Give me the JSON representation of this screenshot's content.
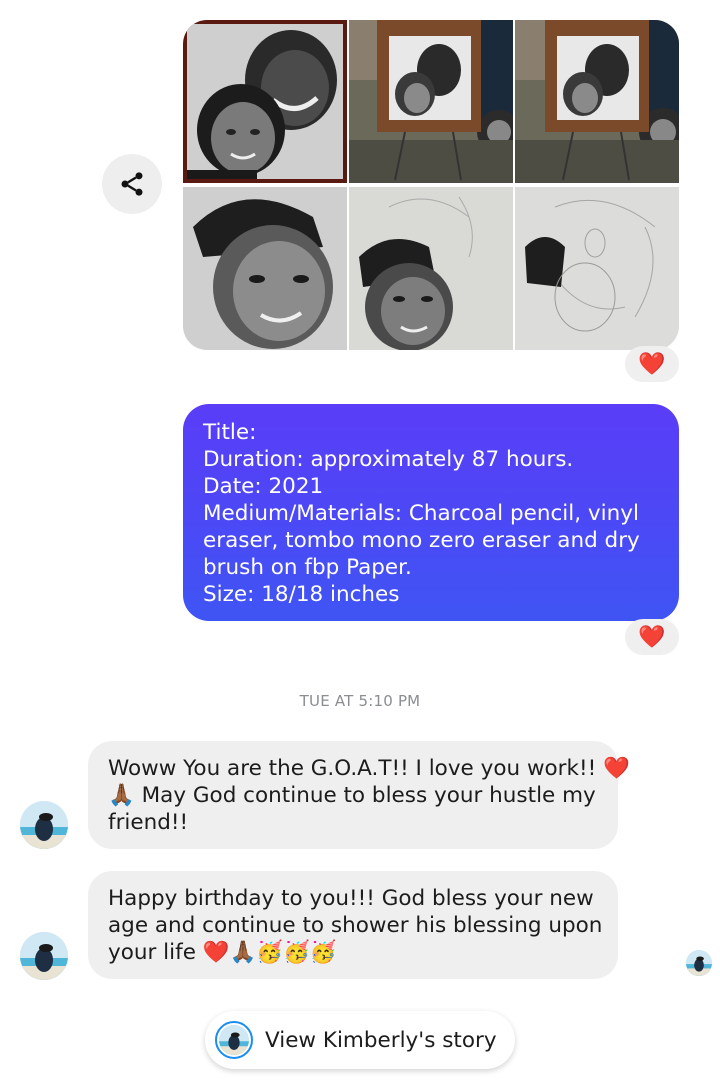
{
  "thread": {
    "photo_grid": {
      "photo_count": 6,
      "photos": [
        {
          "icon": "charcoal-portrait-couple"
        },
        {
          "icon": "portrait-on-easel"
        },
        {
          "icon": "portrait-on-easel"
        },
        {
          "icon": "charcoal-portrait-closeup"
        },
        {
          "icon": "charcoal-portrait-in-progress"
        },
        {
          "icon": "charcoal-portrait-sketch"
        }
      ],
      "reaction": "❤️"
    },
    "outgoing_message": {
      "lines": [
        "Title:",
        "Duration: approximately 87 hours.",
        "Date: 2021",
        "Medium/Materials: Charcoal pencil, vinyl",
        "eraser, tombo mono zero eraser and dry",
        "brush on fbp Paper.",
        "Size: 18/18 inches"
      ],
      "reaction": "❤️"
    },
    "timestamp": "TUE AT 5:10 PM",
    "incoming_messages": [
      {
        "text_before": "Woww You are the G.O.A.T!! I love you work!! ",
        "emoji_inline": "❤️",
        "line2": "🙏🏾 May God continue to bless your hustle my",
        "line3": "friend!!"
      },
      {
        "line1": "Happy birthday to you!!! God bless your new",
        "line2": "age and continue to shower his blessing upon",
        "line3_text": "your life ",
        "line3_emoji": "❤️🙏🏾🥳🥳🥳"
      }
    ],
    "story_button": {
      "label": "View Kimberly's story"
    },
    "colors": {
      "bubble_gradient_top": "#5a3df7",
      "bubble_gradient_bottom": "#3f55f3",
      "incoming_bubble": "#efefef",
      "story_ring": "#1a8ef0",
      "heart": "#e0142a"
    },
    "icons": {
      "share": "share-icon",
      "avatar": "avatar-beach"
    }
  }
}
